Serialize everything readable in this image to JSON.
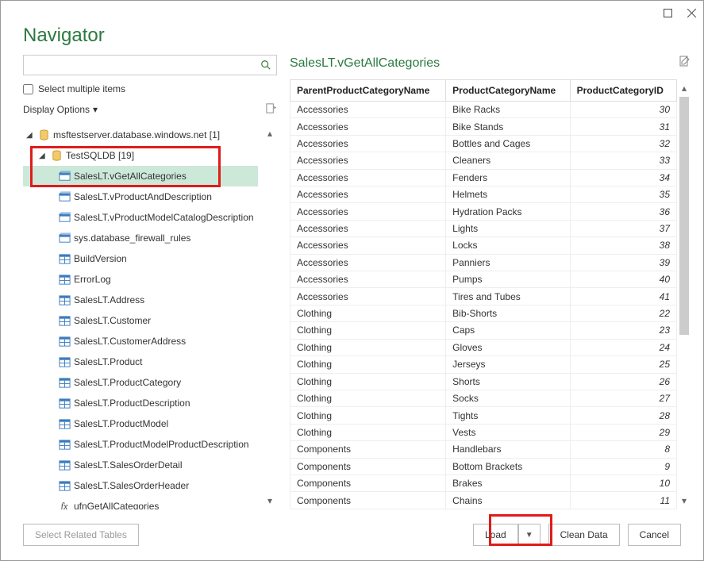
{
  "window_title": "Navigator",
  "search": {
    "placeholder": ""
  },
  "multi_label": "Select multiple items",
  "display_options_label": "Display Options",
  "tree": {
    "server": {
      "label": "msftestserver.database.windows.net [1]"
    },
    "db": {
      "label": "TestSQLDB [19]"
    },
    "items": [
      {
        "label": "SalesLT.vGetAllCategories",
        "type": "view",
        "selected": true
      },
      {
        "label": "SalesLT.vProductAndDescription",
        "type": "view"
      },
      {
        "label": "SalesLT.vProductModelCatalogDescription",
        "type": "view"
      },
      {
        "label": "sys.database_firewall_rules",
        "type": "view"
      },
      {
        "label": "BuildVersion",
        "type": "table"
      },
      {
        "label": "ErrorLog",
        "type": "table"
      },
      {
        "label": "SalesLT.Address",
        "type": "table"
      },
      {
        "label": "SalesLT.Customer",
        "type": "table"
      },
      {
        "label": "SalesLT.CustomerAddress",
        "type": "table"
      },
      {
        "label": "SalesLT.Product",
        "type": "table"
      },
      {
        "label": "SalesLT.ProductCategory",
        "type": "table"
      },
      {
        "label": "SalesLT.ProductDescription",
        "type": "table"
      },
      {
        "label": "SalesLT.ProductModel",
        "type": "table"
      },
      {
        "label": "SalesLT.ProductModelProductDescription",
        "type": "table"
      },
      {
        "label": "SalesLT.SalesOrderDetail",
        "type": "table"
      },
      {
        "label": "SalesLT.SalesOrderHeader",
        "type": "table"
      },
      {
        "label": "ufnGetAllCategories",
        "type": "fx"
      }
    ]
  },
  "preview": {
    "title": "SalesLT.vGetAllCategories",
    "columns": [
      "ParentProductCategoryName",
      "ProductCategoryName",
      "ProductCategoryID"
    ],
    "rows": [
      [
        "Accessories",
        "Bike Racks",
        30
      ],
      [
        "Accessories",
        "Bike Stands",
        31
      ],
      [
        "Accessories",
        "Bottles and Cages",
        32
      ],
      [
        "Accessories",
        "Cleaners",
        33
      ],
      [
        "Accessories",
        "Fenders",
        34
      ],
      [
        "Accessories",
        "Helmets",
        35
      ],
      [
        "Accessories",
        "Hydration Packs",
        36
      ],
      [
        "Accessories",
        "Lights",
        37
      ],
      [
        "Accessories",
        "Locks",
        38
      ],
      [
        "Accessories",
        "Panniers",
        39
      ],
      [
        "Accessories",
        "Pumps",
        40
      ],
      [
        "Accessories",
        "Tires and Tubes",
        41
      ],
      [
        "Clothing",
        "Bib-Shorts",
        22
      ],
      [
        "Clothing",
        "Caps",
        23
      ],
      [
        "Clothing",
        "Gloves",
        24
      ],
      [
        "Clothing",
        "Jerseys",
        25
      ],
      [
        "Clothing",
        "Shorts",
        26
      ],
      [
        "Clothing",
        "Socks",
        27
      ],
      [
        "Clothing",
        "Tights",
        28
      ],
      [
        "Clothing",
        "Vests",
        29
      ],
      [
        "Components",
        "Handlebars",
        8
      ],
      [
        "Components",
        "Bottom Brackets",
        9
      ],
      [
        "Components",
        "Brakes",
        10
      ],
      [
        "Components",
        "Chains",
        11
      ]
    ]
  },
  "footer": {
    "select_related": "Select Related Tables",
    "load": "Load",
    "clean": "Clean Data",
    "cancel": "Cancel"
  }
}
